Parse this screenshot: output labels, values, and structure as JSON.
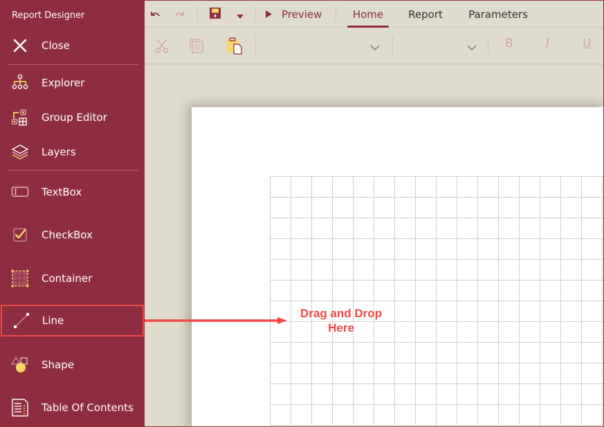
{
  "sidebar": {
    "title": "Report Designer",
    "items": [
      {
        "id": "close",
        "label": "Close",
        "icon": "close-icon"
      },
      {
        "id": "explorer",
        "label": "Explorer",
        "icon": "hierarchy-icon"
      },
      {
        "id": "group-editor",
        "label": "Group Editor",
        "icon": "group-editor-icon"
      },
      {
        "id": "layers",
        "label": "Layers",
        "icon": "layers-icon"
      },
      {
        "id": "textbox",
        "label": "TextBox",
        "icon": "textbox-icon"
      },
      {
        "id": "checkbox",
        "label": "CheckBox",
        "icon": "checkbox-icon"
      },
      {
        "id": "container",
        "label": "Container",
        "icon": "container-icon"
      },
      {
        "id": "line",
        "label": "Line",
        "icon": "line-icon",
        "highlighted": true
      },
      {
        "id": "shape",
        "label": "Shape",
        "icon": "shape-icon"
      },
      {
        "id": "toc",
        "label": "Table Of Contents",
        "icon": "table-of-contents-icon"
      }
    ]
  },
  "toolbar": {
    "undo_icon": "undo-icon",
    "redo_icon": "redo-icon",
    "save_icon": "save-icon",
    "save_dropdown_icon": "caret-down-icon",
    "preview_label": "Preview",
    "tabs": [
      {
        "label": "Home",
        "active": true
      },
      {
        "label": "Report",
        "active": false
      },
      {
        "label": "Parameters",
        "active": false
      }
    ],
    "edit": {
      "cut_icon": "scissors-icon",
      "copy_icon": "copy-icon",
      "paste_icon": "paste-icon"
    },
    "font_family_value": "",
    "font_size_value": "",
    "format": {
      "bold": "B",
      "italic": "I",
      "underline": "U"
    }
  },
  "canvas": {
    "annotation": {
      "line1": "Drag and Drop",
      "line2": "Here",
      "color": "#f04848"
    }
  },
  "colors": {
    "brand": "#8f2d40",
    "toolbar_bg": "#dfdbcd",
    "accent_yellow": "#f5d76e",
    "highlight": "#f04848"
  }
}
